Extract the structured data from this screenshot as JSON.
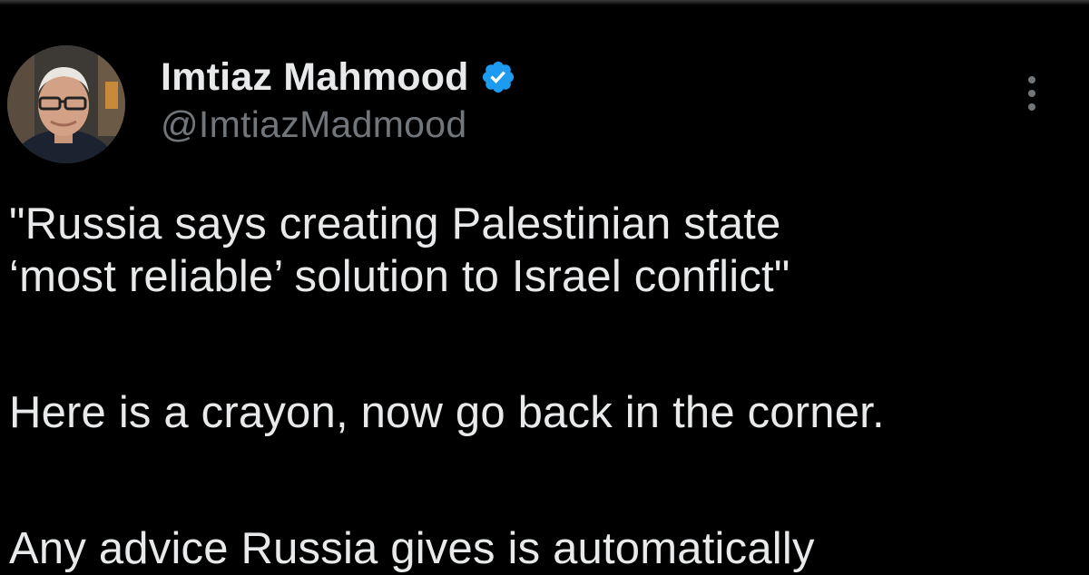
{
  "tweet": {
    "author": {
      "display_name": "Imtiaz Mahmood",
      "handle": "@ImtiazMadmood",
      "verified": true,
      "verified_color": "#1d9bf0"
    },
    "paragraphs": [
      "\"Russia says creating Palestinian state",
      "‘most reliable’ solution to Israel conflict\"",
      "Here is a crayon, now go back in the corner.",
      "Any advice Russia gives is automatically"
    ]
  },
  "icons": {
    "verified": "verified-badge-icon",
    "more": "more-options-icon"
  },
  "colors": {
    "background": "#000000",
    "text": "#e7e9ea",
    "secondary_text": "#71767b"
  }
}
